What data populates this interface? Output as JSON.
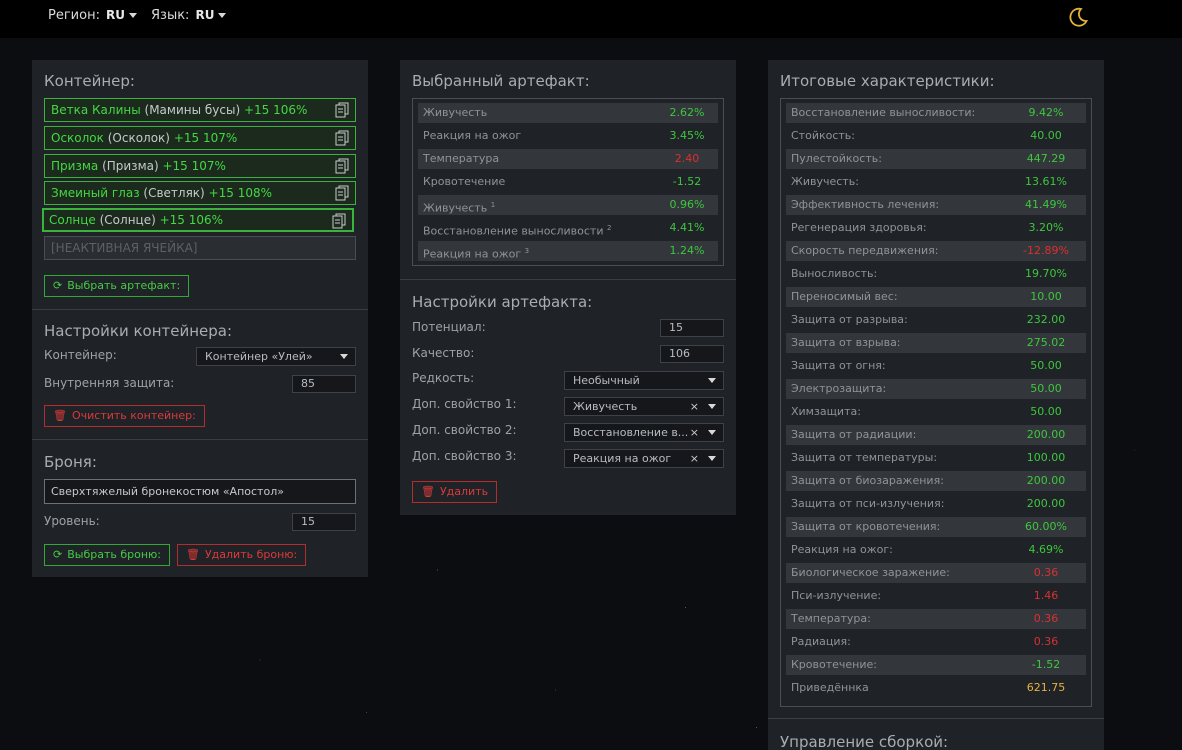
{
  "header": {
    "region_label": "Регион:",
    "region_value": "RU",
    "lang_label": "Язык:",
    "lang_value": "RU"
  },
  "container_panel": {
    "title": "Контейнер:",
    "slots": [
      {
        "name": "Ветка Калины",
        "sub": "(Мамины бусы)",
        "tail": "+15 106%"
      },
      {
        "name": "Осколок",
        "sub": "(Осколок)",
        "tail": "+15 107%"
      },
      {
        "name": "Призма",
        "sub": "(Призма)",
        "tail": "+15 107%"
      },
      {
        "name": "Змеиный глаз",
        "sub": "(Светляк)",
        "tail": "+15 108%"
      },
      {
        "name": "Солнце",
        "sub": "(Солнце)",
        "tail": "+15 106%"
      }
    ],
    "inactive_slot": "[НЕАКТИВНАЯ ЯЧЕЙКА]",
    "choose_artifact": "Выбрать артефакт:",
    "settings_title": "Настройки контейнера:",
    "container_label": "Контейнер:",
    "container_value": "Контейнер «Улей»",
    "inner_protection_label": "Внутренняя защита:",
    "inner_protection_value": "85",
    "clear_container": "Очистить контейнер:",
    "armor_title": "Броня:",
    "armor_value": "Сверхтяжелый бронекостюм «Апостол»",
    "level_label": "Уровень:",
    "level_value": "15",
    "choose_armor": "Выбрать броню:",
    "delete_armor": "Удалить броню:"
  },
  "artifact_panel": {
    "title": "Выбранный артефакт:",
    "stats": [
      {
        "name": "Живучесть",
        "sup": "",
        "value": "2.62%",
        "tone": "pos"
      },
      {
        "name": "Реакция на ожог",
        "sup": "",
        "value": "3.45%",
        "tone": "pos"
      },
      {
        "name": "Температура",
        "sup": "",
        "value": "2.40",
        "tone": "neg"
      },
      {
        "name": "Кровотечение",
        "sup": "",
        "value": "-1.52",
        "tone": "pos"
      },
      {
        "name": "Живучесть",
        "sup": "1",
        "value": "0.96%",
        "tone": "pos"
      },
      {
        "name": "Восстановление выносливости",
        "sup": "2",
        "value": "4.41%",
        "tone": "pos"
      },
      {
        "name": "Реакция на ожог",
        "sup": "3",
        "value": "1.24%",
        "tone": "pos"
      }
    ],
    "settings_title": "Настройки артефакта:",
    "potential_label": "Потенциал:",
    "potential_value": "15",
    "quality_label": "Качество:",
    "quality_value": "106",
    "rarity_label": "Редкость:",
    "rarity_value": "Необычный",
    "extra1_label": "Доп. свойство 1:",
    "extra1_value": "Живучесть",
    "extra2_label": "Доп. свойство 2:",
    "extra2_value": "Восстановление в...",
    "extra3_label": "Доп. свойство 3:",
    "extra3_value": "Реакция на ожог",
    "clear_glyph": "×",
    "delete": "Удалить"
  },
  "totals_panel": {
    "title": "Итоговые характеристики:",
    "stats": [
      {
        "name": "Восстановление выносливости:",
        "value": "9.42%",
        "tone": "pos"
      },
      {
        "name": "Стойкость:",
        "value": "40.00",
        "tone": "pos"
      },
      {
        "name": "Пулестойкость:",
        "value": "447.29",
        "tone": "pos"
      },
      {
        "name": "Живучесть:",
        "value": "13.61%",
        "tone": "pos"
      },
      {
        "name": "Эффективность лечения:",
        "value": "41.49%",
        "tone": "pos"
      },
      {
        "name": "Регенерация здоровья:",
        "value": "3.20%",
        "tone": "pos"
      },
      {
        "name": "Скорость передвижения:",
        "value": "-12.89%",
        "tone": "neg"
      },
      {
        "name": "Выносливость:",
        "value": "19.70%",
        "tone": "pos"
      },
      {
        "name": "Переносимый вес:",
        "value": "10.00",
        "tone": "pos"
      },
      {
        "name": "Защита от разрыва:",
        "value": "232.00",
        "tone": "pos"
      },
      {
        "name": "Защита от взрыва:",
        "value": "275.02",
        "tone": "pos"
      },
      {
        "name": "Защита от огня:",
        "value": "50.00",
        "tone": "pos"
      },
      {
        "name": "Электрозащита:",
        "value": "50.00",
        "tone": "pos"
      },
      {
        "name": "Химзащита:",
        "value": "50.00",
        "tone": "pos"
      },
      {
        "name": "Защита от радиации:",
        "value": "200.00",
        "tone": "pos"
      },
      {
        "name": "Защита от температуры:",
        "value": "100.00",
        "tone": "pos"
      },
      {
        "name": "Защита от биозаражения:",
        "value": "200.00",
        "tone": "pos"
      },
      {
        "name": "Защита от пси-излучения:",
        "value": "200.00",
        "tone": "pos"
      },
      {
        "name": "Защита от кровотечения:",
        "value": "60.00%",
        "tone": "pos"
      },
      {
        "name": "Реакция на ожог:",
        "value": "4.69%",
        "tone": "pos"
      },
      {
        "name": "Биологическое заражение:",
        "value": "0.36",
        "tone": "neg"
      },
      {
        "name": "Пси-излучение:",
        "value": "1.46",
        "tone": "neg"
      },
      {
        "name": "Температура:",
        "value": "0.36",
        "tone": "neg"
      },
      {
        "name": "Радиация:",
        "value": "0.36",
        "tone": "neg"
      },
      {
        "name": "Кровотечение:",
        "value": "-1.52",
        "tone": "pos"
      },
      {
        "name": "Приведённка",
        "value": "621.75",
        "tone": "gold"
      }
    ],
    "build_title": "Управление сборкой:"
  },
  "colors": {
    "accent_green": "#43d843",
    "danger_red": "#dc3a3a",
    "gold": "#e6b23c",
    "panel_bg": "#1f2226"
  }
}
